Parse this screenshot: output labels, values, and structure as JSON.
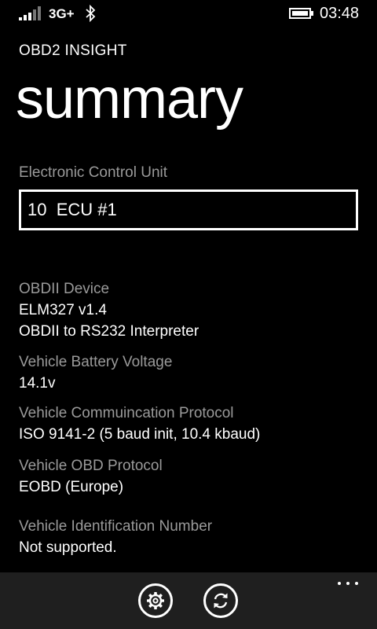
{
  "status_bar": {
    "network": "3G+",
    "time": "03:48",
    "icons": [
      "signal-icon",
      "bluetooth-icon",
      "battery-icon"
    ]
  },
  "app": {
    "title": "OBD2 INSIGHT",
    "page_title": "summary"
  },
  "ecu": {
    "label": "Electronic Control Unit",
    "selected": "10  ECU #1"
  },
  "info": [
    {
      "label": "OBDII Device",
      "values": [
        "ELM327 v1.4",
        "OBDII to RS232 Interpreter"
      ]
    },
    {
      "label": "Vehicle Battery Voltage",
      "values": [
        "14.1v"
      ]
    },
    {
      "label": "Vehicle Commuincation Protocol",
      "values": [
        "ISO 9141-2 (5 baud init, 10.4 kbaud)"
      ]
    },
    {
      "label": "Vehicle OBD Protocol",
      "values": [
        "EOBD (Europe)"
      ]
    },
    {
      "label": "Vehicle Identification Number",
      "values": [
        "Not supported."
      ]
    }
  ],
  "app_bar": {
    "buttons": [
      "settings-icon",
      "refresh-icon"
    ],
    "more": "ellipsis-icon"
  }
}
